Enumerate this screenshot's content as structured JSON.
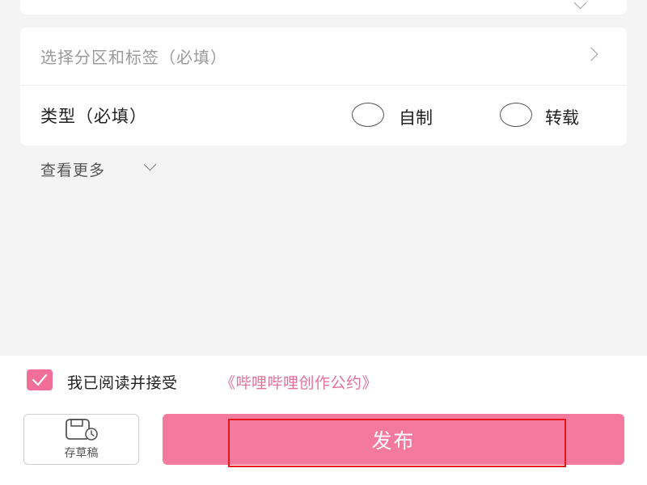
{
  "form": {
    "category_placeholder": "选择分区和标签（必填）",
    "type_label": "类型（必填）",
    "type_options": [
      "自制",
      "转载"
    ],
    "more_label": "查看更多"
  },
  "agreement": {
    "checked": true,
    "text": "我已阅读并接受",
    "link": "《哔哩哔哩创作公约》"
  },
  "actions": {
    "draft_label": "存草稿",
    "publish_label": "发布"
  },
  "colors": {
    "accent": "#f4799e",
    "link": "#e2729a",
    "highlight_box": "#e8141b"
  },
  "icons": {
    "category_arrow": "chevron-right-icon",
    "more_arrow": "chevron-down-icon",
    "draft": "draft-save-icon",
    "checkbox": "checkmark-icon"
  }
}
